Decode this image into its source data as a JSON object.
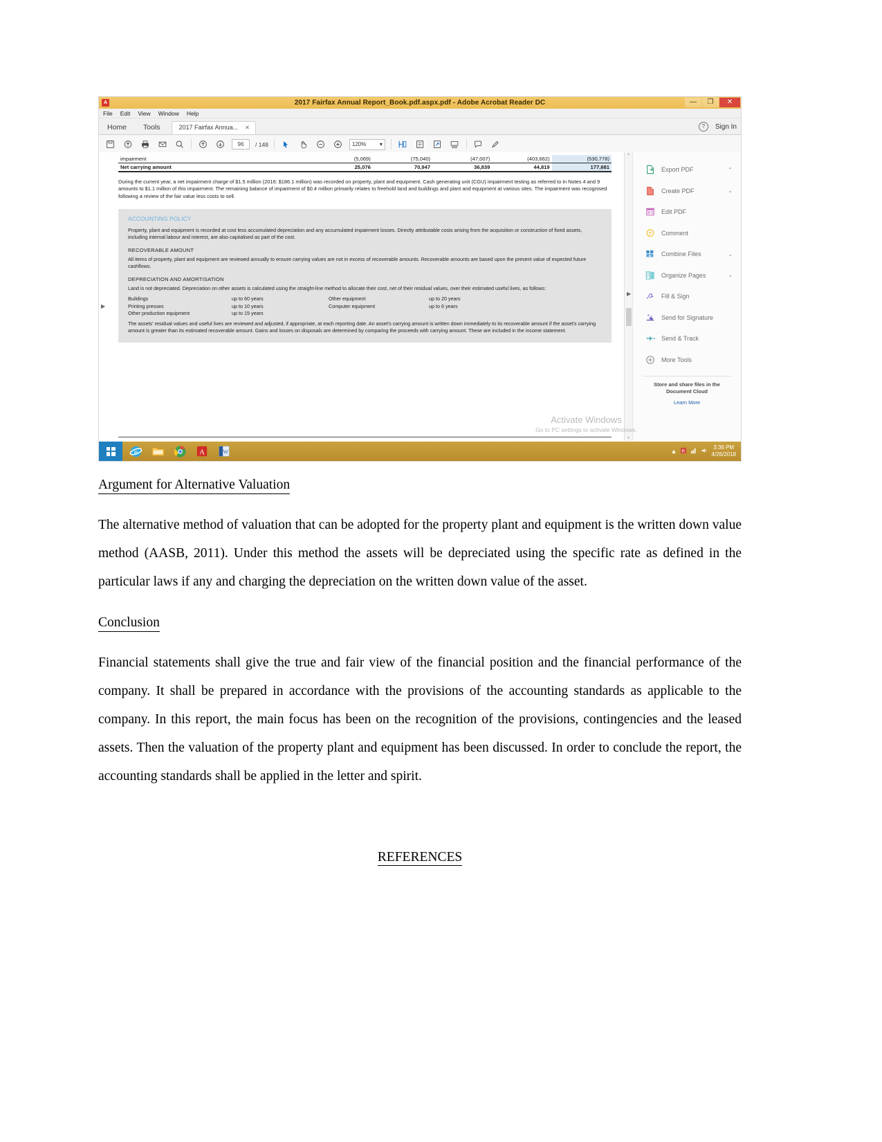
{
  "screenshot": {
    "titlebar": {
      "title": "2017 Fairfax Annual Report_Book.pdf.aspx.pdf - Adobe Acrobat Reader DC",
      "app_icon": "acrobat-icon",
      "minimize": "—",
      "restore": "❐",
      "close": "✕"
    },
    "menubar": [
      "File",
      "Edit",
      "View",
      "Window",
      "Help"
    ],
    "tabs": {
      "home": "Home",
      "tools": "Tools",
      "document": "2017 Fairfax Annua...",
      "close_glyph": "✕",
      "help_glyph": "?",
      "signin": "Sign In"
    },
    "toolbar": {
      "page_current": "96",
      "page_total": "/ 148",
      "zoom_value": "120%",
      "zoom_caret": "▾",
      "icons": [
        "save-icon",
        "upload-cloud-icon",
        "print-icon",
        "email-icon",
        "search-icon",
        "previous-page-icon",
        "next-page-icon",
        "select-tool-icon",
        "hand-tool-icon",
        "zoom-out-icon",
        "zoom-in-icon",
        "fit-width-icon",
        "fit-page-icon",
        "rotate-icon",
        "read-mode-icon",
        "comment-icon",
        "highlight-icon"
      ]
    },
    "pdf": {
      "table": {
        "rows": [
          {
            "label": "impairment",
            "values": [
              "(5,069)",
              "(75,040)",
              "(47,007)",
              "(403,662)",
              "(530,778)"
            ]
          },
          {
            "label": "Net carrying amount",
            "values": [
              "25,076",
              "70,947",
              "36,839",
              "44,819",
              "177,681"
            ]
          }
        ]
      },
      "paragraph": "During the current year, a net impairment charge of $1.5 million (2016: $186.1 million) was recorded on property, plant and equipment. Cash generating unit (CGU) impairment testing as referred to in Notes 4 and 9 amounts to $1.1 million of this impairment. The remaining balance of impairment of $0.4 million primarily relates to freehold land and buildings and plant and equipment at various sites. The impairment was recognised following a review of the fair value less costs to sell.",
      "policy": {
        "heading": "ACCOUNTING POLICY",
        "intro": "Property, plant and equipment is recorded at cost less accumulated depreciation and any accumulated impairment losses. Directly attributable costs arising from the acquisition or construction of fixed assets, including internal labour and interest, are also capitalised as part of the cost.",
        "recoverable_heading": "RECOVERABLE AMOUNT",
        "recoverable_text": "All items of property, plant and equipment are reviewed annually to ensure carrying values are not in excess of recoverable amounts. Recoverable amounts are based upon the present value of expected future cashflows.",
        "depreciation_heading": "DEPRECIATION AND AMORTISATION",
        "depreciation_text": "Land is not depreciated. Depreciation on other assets is calculated using the straight-line method to allocate their cost, net of their residual values, over their estimated useful lives, as follows:",
        "lives": [
          {
            "asset_a": "Buildings",
            "life_a": "up to 60 years",
            "asset_b": "Other equipment",
            "life_b": "up to 20 years"
          },
          {
            "asset_a": "Printing presses",
            "life_a": "up to 10 years",
            "asset_b": "Computer equipment",
            "life_b": "up to 6 years"
          },
          {
            "asset_a": "Other production equipment",
            "life_a": "up to 15 years",
            "asset_b": "",
            "life_b": ""
          }
        ],
        "closing_text": "The assets' residual values and useful lives are reviewed and adjusted, if appropriate, at each reporting date. An asset's carrying amount is written down immediately to its recoverable amount if the asset's carrying amount is greater than its estimated recoverable amount. Gains and losses on disposals are determined by comparing the proceeds with carrying amount. These are included in the income statement."
      }
    },
    "right_panel": {
      "items": [
        {
          "label": "Export PDF",
          "icon": "export-pdf-icon",
          "chevron": "⌃"
        },
        {
          "label": "Create PDF",
          "icon": "create-pdf-icon",
          "chevron": "⌄"
        },
        {
          "label": "Edit PDF",
          "icon": "edit-pdf-icon",
          "chevron": ""
        },
        {
          "label": "Comment",
          "icon": "comment-icon",
          "chevron": ""
        },
        {
          "label": "Combine Files",
          "icon": "combine-files-icon",
          "chevron": "⌄"
        },
        {
          "label": "Organize Pages",
          "icon": "organize-pages-icon",
          "chevron": "⌄"
        },
        {
          "label": "Fill & Sign",
          "icon": "fill-and-sign-icon",
          "chevron": ""
        },
        {
          "label": "Send for Signature",
          "icon": "send-for-signature-icon",
          "chevron": ""
        },
        {
          "label": "Send & Track",
          "icon": "send-and-track-icon",
          "chevron": ""
        },
        {
          "label": "More Tools",
          "icon": "more-tools-icon",
          "chevron": ""
        }
      ],
      "promo_line1": "Store and share files in the",
      "promo_line2": "Document Cloud",
      "learn_more": "Learn More"
    },
    "watermark": {
      "line1": "Activate Windows",
      "line2": "Go to PC settings to activate Windows."
    },
    "taskbar": {
      "start": "windows-start-icon",
      "apps": [
        "internet-explorer-icon",
        "file-explorer-icon",
        "chrome-icon",
        "acrobat-reader-icon",
        "word-icon"
      ],
      "tray": [
        "show-hidden-icons",
        "network-icon",
        "antivirus-icon",
        "volume-icon"
      ],
      "time": "3:36 PM",
      "date": "4/26/2018"
    }
  },
  "document": {
    "heading_1": "Argument for Alternative Valuation",
    "para_1": "The alternative method of valuation that can be adopted for the property plant and equipment is the written down value method (AASB, 2011). Under this method the assets will be depreciated using the specific rate as defined in the particular laws if any and charging the depreciation on the written down value of the asset.",
    "heading_2": "Conclusion",
    "para_2": "Financial statements shall give the true and fair view of the financial position and the financial performance of the company. It shall be prepared in accordance with the provisions of the accounting standards as applicable to the company. In this report, the main focus has been on the recognition of the provisions, contingencies and the leased assets. Then the valuation of the property plant and equipment has been discussed. In order to conclude the report, the accounting standards shall be applied in the letter and spirit.",
    "references_heading": "REFERENCES"
  }
}
